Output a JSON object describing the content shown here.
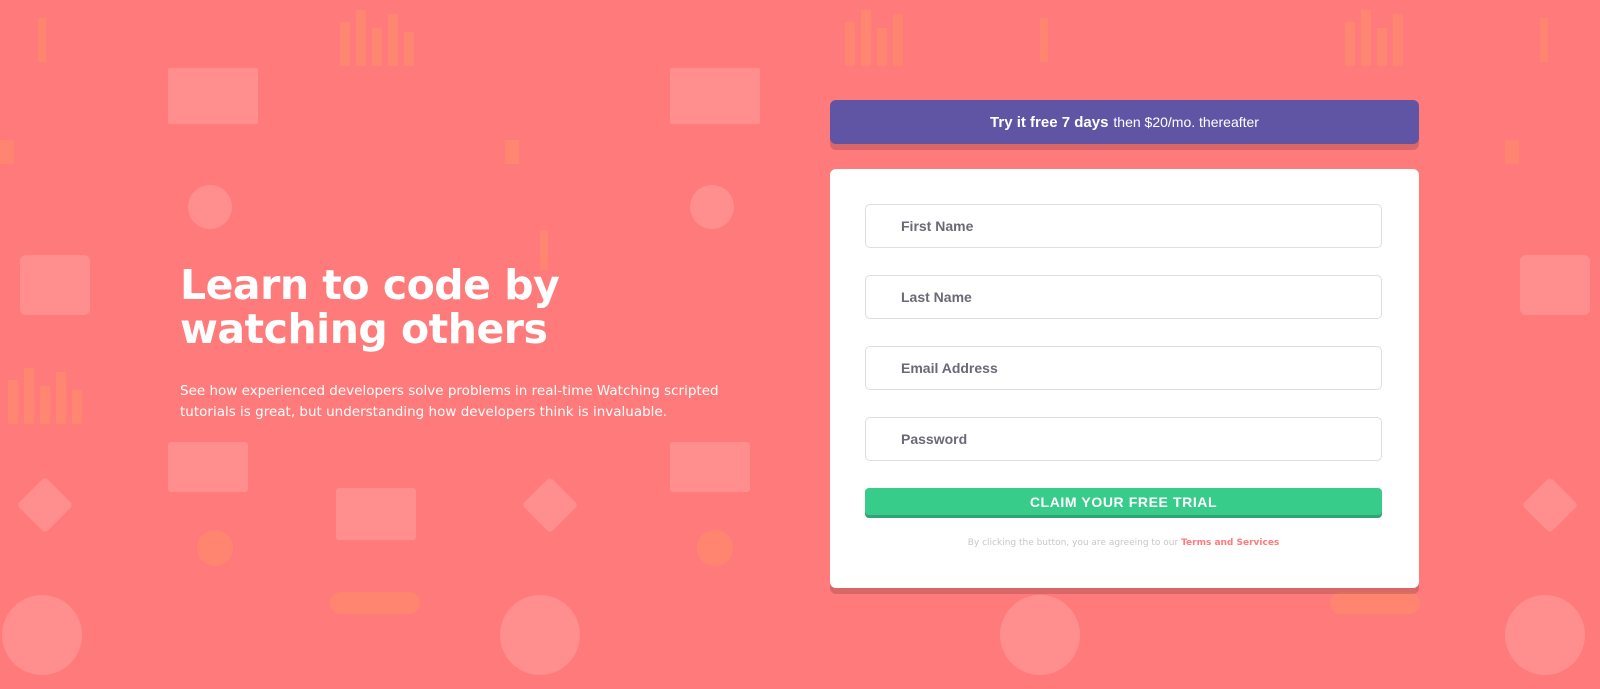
{
  "hero": {
    "title": "Learn to code by watching others",
    "description": "See how experienced developers solve problems in real-time Watching scripted tutorials is great, but understanding how developers think is invaluable."
  },
  "offer": {
    "bold": "Try it free 7 days",
    "rest": "then $20/mo. thereafter"
  },
  "form": {
    "first_name_placeholder": "First Name",
    "last_name_placeholder": "Last Name",
    "email_placeholder": "Email Address",
    "password_placeholder": "Password",
    "submit_label": "CLAIM YOUR FREE TRIAL",
    "terms_prefix": "By clicking the button, you are agreeing to our",
    "terms_link": "Terms and Services"
  },
  "colors": {
    "background": "#ff7a7a",
    "offer_bar": "#6055a5",
    "submit": "#38cc8b",
    "link": "#ff7a7a"
  }
}
